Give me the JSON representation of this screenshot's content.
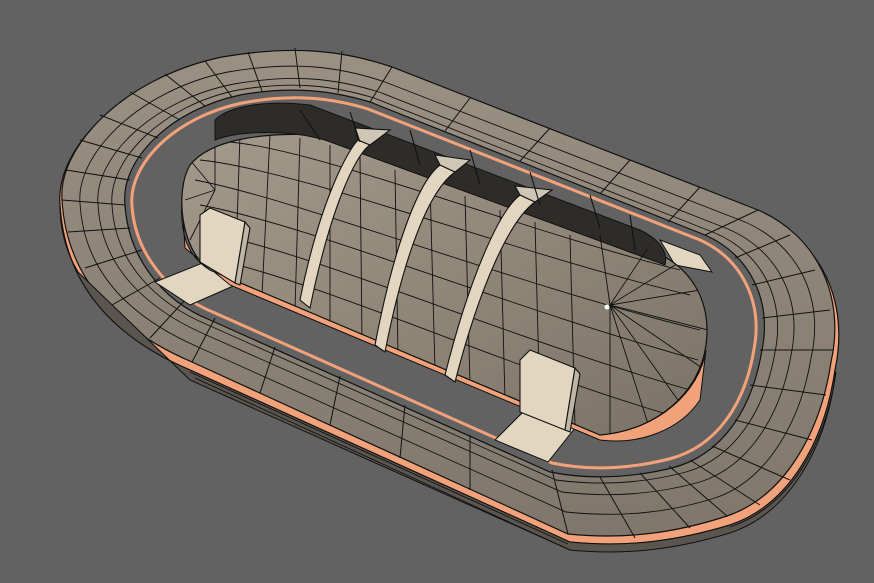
{
  "viewport": {
    "background": "#626262"
  },
  "model": {
    "style": "wireframe-over-shaded",
    "colors": {
      "surface": "#8e8578",
      "surface_dark": "#6e675d",
      "surface_light": "#cfc6b6",
      "highlight_face": "#e2d6c0",
      "edge": "#111111",
      "rim": "#f2a27a",
      "rim_dark": "#d98458",
      "shadow": "#3a3a3a"
    },
    "parts": [
      "outer-ring-track",
      "inner-dome",
      "dome-arches",
      "support-pillars",
      "gate-ramps"
    ]
  }
}
